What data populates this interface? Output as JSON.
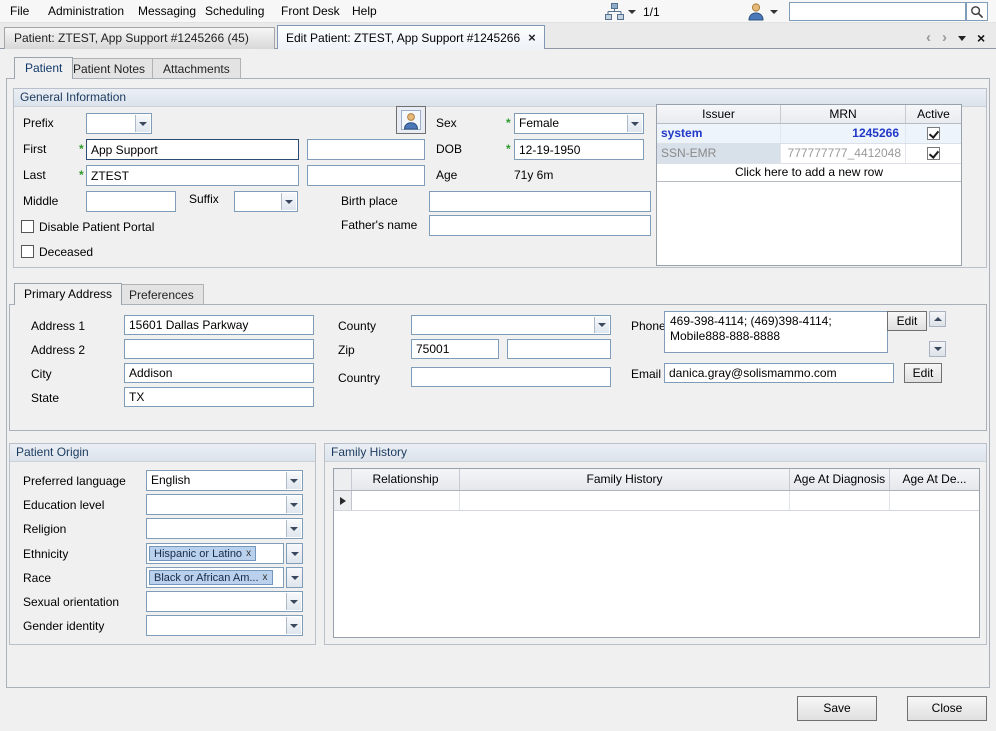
{
  "menubar": {
    "items": [
      {
        "label": "File"
      },
      {
        "label": "Administration"
      },
      {
        "label": "Messaging"
      },
      {
        "label": "Scheduling"
      },
      {
        "label": "Front Desk"
      },
      {
        "label": "Help"
      }
    ],
    "page_counter": "1/1",
    "search": {
      "value": "",
      "placeholder": ""
    }
  },
  "icons": {
    "close": "×",
    "prev": "‹",
    "next": "›",
    "chip_remove": "x"
  },
  "doc_tabs": {
    "inactive_label": "Patient: ZTEST, App Support #1245266 (45)",
    "active_label": "Edit Patient: ZTEST, App Support #1245266"
  },
  "view_tabs": [
    {
      "label": "Patient"
    },
    {
      "label": "Patient Notes"
    },
    {
      "label": "Attachments"
    }
  ],
  "general_info": {
    "title": "General Information",
    "required_marker": "*",
    "prefix_label": "Prefix",
    "first_label": "First",
    "first_value": "App Support",
    "last_label": "Last",
    "last_value": "ZTEST",
    "middle_label": "Middle",
    "suffix_label": "Suffix",
    "sex_label": "Sex",
    "sex_value": "Female",
    "dob_label": "DOB",
    "dob_value": "12-19-1950",
    "age_label": "Age",
    "age_value": "71y 6m",
    "birthplace_label": "Birth place",
    "fathers_name_label": "Father's name",
    "disable_portal_label": "Disable Patient Portal",
    "deceased_label": "Deceased"
  },
  "mrn_grid": {
    "headers": [
      "Issuer",
      "MRN",
      "Active"
    ],
    "rows": [
      {
        "issuer": "system",
        "mrn": "1245266"
      },
      {
        "issuer": "SSN-EMR",
        "mrn": "777777777_4412048"
      }
    ],
    "add_row_label": "Click here to add a new row"
  },
  "address_tabs": [
    {
      "label": "Primary Address"
    },
    {
      "label": "Preferences"
    }
  ],
  "address": {
    "address1_label": "Address 1",
    "address1_value": "15601 Dallas Parkway",
    "address2_label": "Address 2",
    "city_label": "City",
    "city_value": "Addison",
    "state_label": "State",
    "state_value": "TX",
    "county_label": "County",
    "zip_label": "Zip",
    "zip_value": "75001",
    "country_label": "Country",
    "phone_label": "Phone",
    "phone_value": "469-398-4114; (469)398-4114; Mobile888-888-8888",
    "phone_edit_label": "Edit",
    "email_label": "Email",
    "email_value": "danica.gray@solismammo.com",
    "email_edit_label": "Edit"
  },
  "patient_origin": {
    "title": "Patient Origin",
    "preferred_language_label": "Preferred language",
    "preferred_language_value": "English",
    "education_label": "Education level",
    "religion_label": "Religion",
    "ethnicity_label": "Ethnicity",
    "ethnicity_chip": "Hispanic or Latino",
    "race_label": "Race",
    "race_chip": "Black or African Am...",
    "sexual_orientation_label": "Sexual orientation",
    "gender_identity_label": "Gender identity"
  },
  "family_history": {
    "title": "Family History",
    "headers": [
      "Relationship",
      "Family History",
      "Age At Diagnosis",
      "Age At De..."
    ]
  },
  "footer": {
    "save_label": "Save",
    "close_label": "Close"
  }
}
